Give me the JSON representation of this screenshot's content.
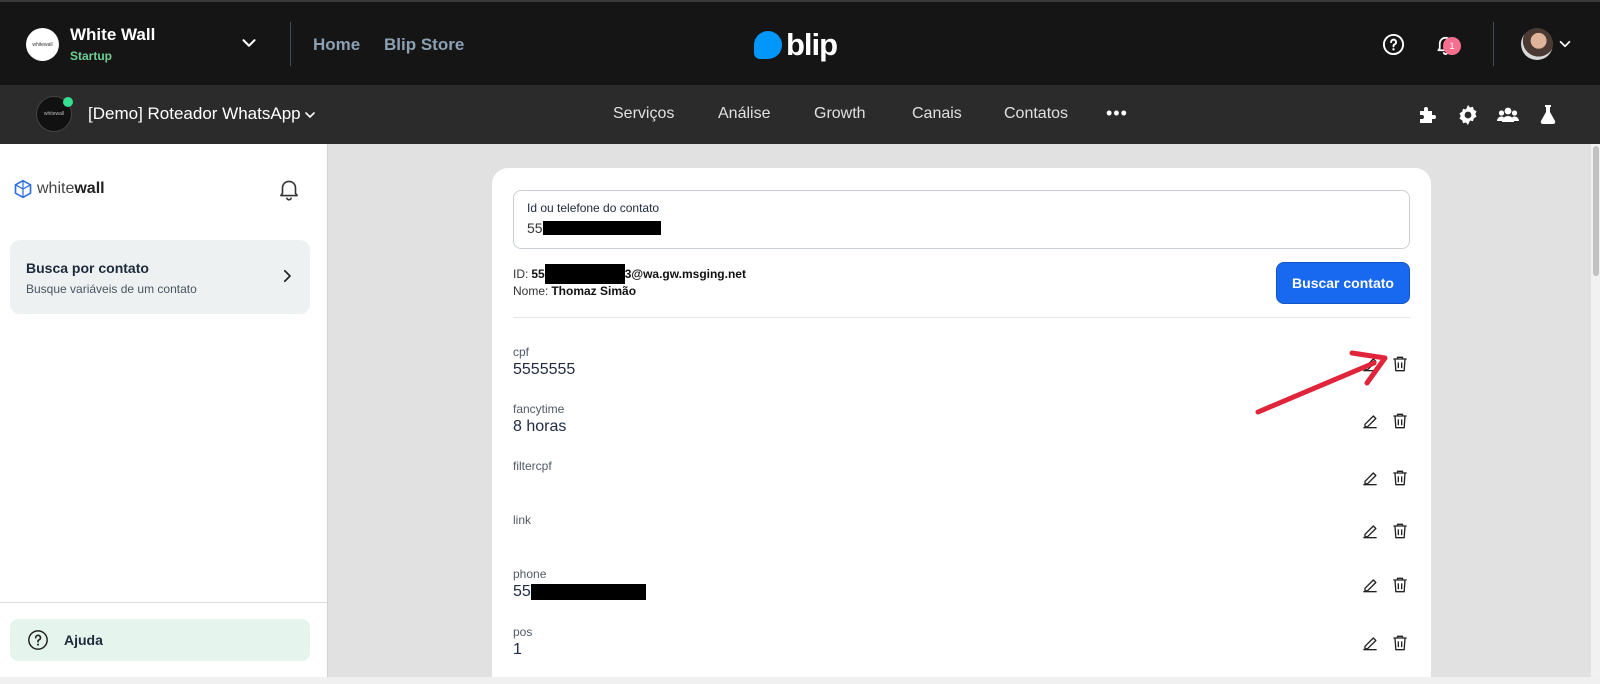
{
  "topbar": {
    "org_avatar_text": "whitewall",
    "org_name": "White Wall",
    "org_plan": "Startup",
    "nav": [
      "Home",
      "Blip Store"
    ],
    "logo_text": "blip",
    "notification_count": "1"
  },
  "subbar": {
    "bot_avatar_text": "whitewall",
    "bot_name": "[Demo] Roteador WhatsApp",
    "menu": [
      "Serviços",
      "Análise",
      "Growth",
      "Canais",
      "Contatos"
    ],
    "more": "•••"
  },
  "sidebar": {
    "brand_light": "white",
    "brand_bold": "wall",
    "card_title": "Busca por contato",
    "card_subtitle": "Busque variáveis de um contato",
    "help_label": "Ajuda"
  },
  "search": {
    "label": "Id ou telefone do contato",
    "value_prefix": "55"
  },
  "contact": {
    "id_label": "ID:",
    "id_prefix": "55",
    "id_suffix": "3@wa.gw.msging.net",
    "name_label": "Nome:",
    "name_value": "Thomaz Simão",
    "search_button": "Buscar contato"
  },
  "variables": [
    {
      "key": "cpf",
      "value": "5555555"
    },
    {
      "key": "fancytime",
      "value": "8 horas"
    },
    {
      "key": "filtercpf",
      "value": ""
    },
    {
      "key": "link",
      "value": ""
    },
    {
      "key": "phone",
      "value": "55"
    },
    {
      "key": "pos",
      "value": "1"
    }
  ],
  "colors": {
    "accent": "#1968f0",
    "annotation_arrow": "#e0243a",
    "online": "#35de90",
    "plan": "#6fcf97"
  }
}
